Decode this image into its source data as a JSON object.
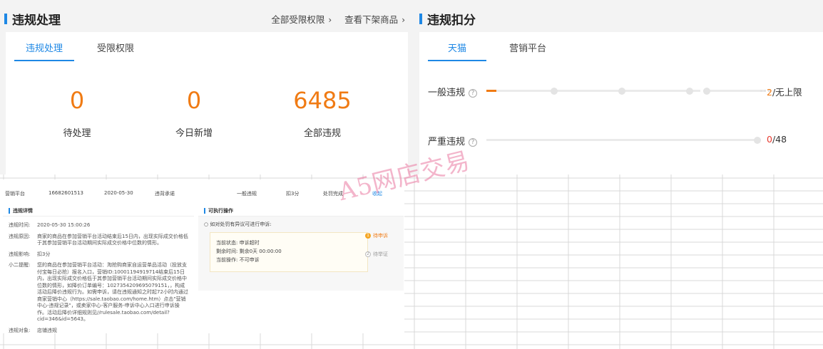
{
  "left": {
    "title": "违规处理",
    "links": [
      {
        "label": "全部受限权限"
      },
      {
        "label": "查看下架商品"
      }
    ],
    "tabs": [
      {
        "label": "违规处理"
      },
      {
        "label": "受限权限"
      }
    ],
    "stats": [
      {
        "value": "0",
        "label": "待处理"
      },
      {
        "value": "0",
        "label": "今日新增"
      },
      {
        "value": "6485",
        "label": "全部违规"
      }
    ]
  },
  "right": {
    "title": "违规扣分",
    "tabs": [
      {
        "label": "天猫"
      },
      {
        "label": "营销平台"
      }
    ],
    "rows": [
      {
        "label": "一般违规",
        "current": "2",
        "limit": "/无上限",
        "progress": 0.04
      },
      {
        "label": "严重违规",
        "current": "0",
        "limit": "/48",
        "progress": 0
      }
    ]
  },
  "detail": {
    "summary": [
      "营销平台",
      "16682601513",
      "2020-05-30",
      "违背承诺",
      "一般违规",
      "扣3分",
      "处罚完成",
      "收起"
    ],
    "left_header": "违规详情",
    "items": [
      {
        "k": "违规时间:",
        "v": "2020-05-30 15:00:26"
      },
      {
        "k": "违规原因:",
        "v": "商家的商品在参加营销平台活动结束后15日内，出现实际成交价格低于其参加营销平台活动期间实际成交价格中位数的情形。"
      },
      {
        "k": "违规影响:",
        "v": "扣3分"
      },
      {
        "k": "小二提醒:",
        "v": "您的商品在参加营销平台活动：淘抢购商家自运营单品活动（投放支付宝每日必抢）报名入口，营销ID:10001194919714结束后15日内，出现实际成交价格低于其参加营销平台活动期间实际成交价格中位数的情形，如降价订单编号：1027354209695079151，，构成活动后降价违规行为。如需申诉，请在违规通知之时起72小时内通过商家营销中心（https://sale.taobao.com/home.htm）点击\"营销中心-违规记录\"，或卖家中心-客户服务-申诉中心入口进行申诉操作。活动后降价详细规则见//rulesale.taobao.com/detail?cid=346&id=5643。"
      },
      {
        "k": "违规对象:",
        "v": "店铺违规"
      }
    ],
    "right_header": "可执行操作",
    "question": "如对处罚有异议可进行申诉:",
    "box_lines": [
      "当前状态:  申诉超时",
      "剩余时间:  剩余0天 00:00:00",
      "当前操作:  不可申诉"
    ],
    "steps": [
      "待申诉",
      "待举证"
    ]
  },
  "watermark": "A5网店交易",
  "colors": {
    "accent_blue": "#1e88e5",
    "accent_orange": "#f07b14",
    "accent_red": "#e6392e"
  }
}
